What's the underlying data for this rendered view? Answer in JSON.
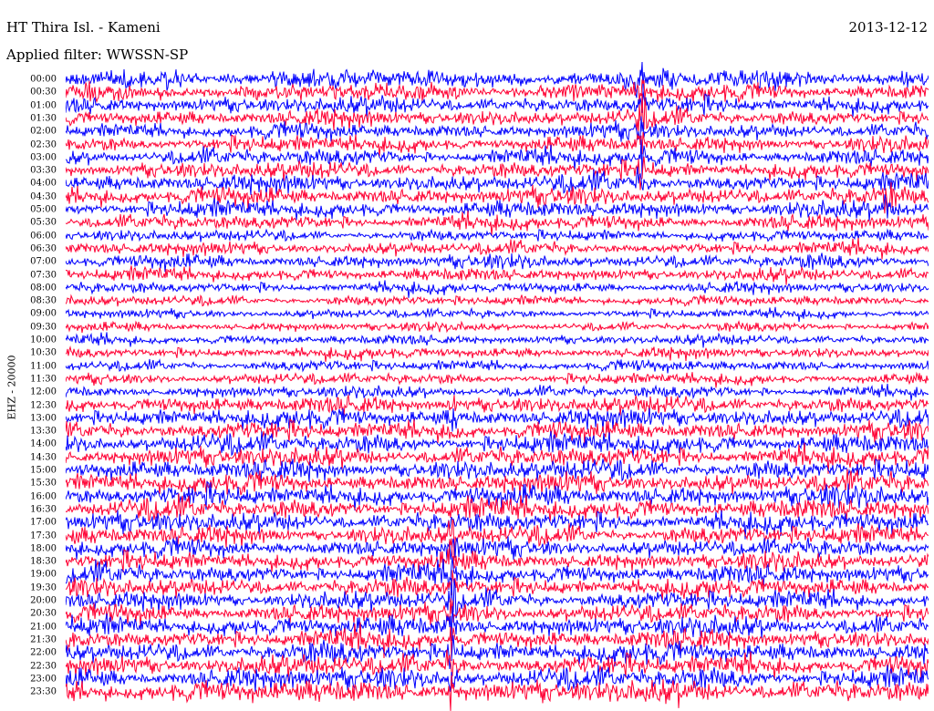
{
  "header": {
    "station": "HT Thira Isl. - Kameni",
    "date": "2013-12-12",
    "filter": "Applied filter: WWSSN-SP"
  },
  "channel_label": "EHZ - 20000",
  "chart_data": {
    "type": "line",
    "title": "HT Thira Isl. - Kameni",
    "ylabel": "EHZ - 20000",
    "row_labels": [
      "00:00",
      "00:30",
      "01:00",
      "01:30",
      "02:00",
      "02:30",
      "03:00",
      "03:30",
      "04:00",
      "04:30",
      "05:00",
      "05:30",
      "06:00",
      "06:30",
      "07:00",
      "07:30",
      "08:00",
      "08:30",
      "09:00",
      "09:30",
      "10:00",
      "10:30",
      "11:00",
      "11:30",
      "12:00",
      "12:30",
      "13:00",
      "13:30",
      "14:00",
      "14:30",
      "15:00",
      "15:30",
      "16:00",
      "16:30",
      "17:00",
      "17:30",
      "18:00",
      "18:30",
      "19:00",
      "19:30",
      "20:00",
      "20:30",
      "21:00",
      "21:30",
      "22:00",
      "22:30",
      "23:00",
      "23:30"
    ],
    "trace_colors": [
      "#0000ff",
      "#ff0033"
    ],
    "relative_amplitude": [
      1.0,
      0.9,
      0.85,
      0.85,
      0.8,
      0.8,
      0.85,
      0.85,
      0.9,
      0.9,
      0.85,
      0.75,
      0.55,
      0.65,
      0.7,
      0.65,
      0.55,
      0.5,
      0.45,
      0.45,
      0.5,
      0.55,
      0.55,
      0.55,
      0.6,
      0.85,
      0.95,
      0.95,
      1.0,
      1.0,
      1.0,
      1.0,
      1.05,
      1.05,
      1.0,
      0.95,
      0.9,
      0.9,
      0.95,
      0.95,
      0.95,
      0.95,
      1.0,
      1.0,
      1.05,
      1.05,
      1.1,
      1.15
    ],
    "events": [
      {
        "time": "00:00",
        "duration_rows": 9,
        "position": 0.667,
        "strength": 2.0
      },
      {
        "time": "04:30",
        "duration_rows": 2,
        "position": 0.952,
        "strength": 1.4
      },
      {
        "time": "12:30",
        "duration_rows": 3,
        "position": 0.448,
        "strength": 1.4
      },
      {
        "time": "17:30",
        "duration_rows": 7,
        "position": 0.448,
        "strength": 2.0
      },
      {
        "time": "21:00",
        "duration_rows": 6,
        "position": 0.448,
        "strength": 2.4
      }
    ]
  }
}
